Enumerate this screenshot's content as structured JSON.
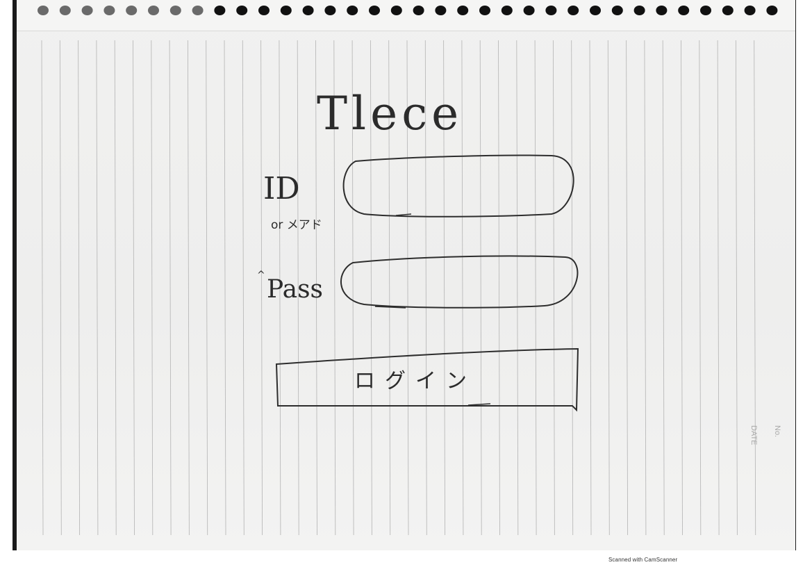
{
  "app_title": "Tlece",
  "login_form": {
    "id_label": "ID",
    "id_sublabel": "or メアド",
    "id_value": "",
    "password_label": "Pass",
    "password_value": "",
    "login_button_label": "ログイン"
  },
  "notebook": {
    "no_label": "No.",
    "date_label": "DATE"
  },
  "scanner_watermark": "Scanned with CamScanner",
  "colors": {
    "paper": "#efefee",
    "ink": "#2d2d2d",
    "rule_line": "#b9b9b9"
  }
}
